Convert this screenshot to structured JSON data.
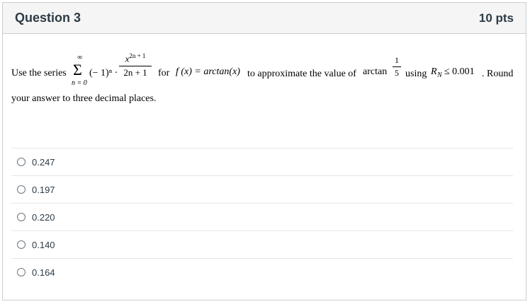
{
  "question": {
    "title": "Question 3",
    "points": "10 pts",
    "text_use_the_series": "Use the series",
    "sum_upper": "∞",
    "sum_symbol": "Σ",
    "sum_lower": "n = 0",
    "term_sign": "(− 1)ⁿ ·",
    "frac_num_base": "x",
    "frac_num_exp": "2n + 1",
    "frac_den": "2n + 1",
    "text_for": "for",
    "function": "f (x) = arctan(x)",
    "text_to_approx": "to approximate the value of",
    "arctan": "arctan",
    "arg_num": "1",
    "arg_den": "5",
    "text_using": "using",
    "condition": "R",
    "condition_sub": "N",
    "condition_rest": "≤ 0.001",
    "text_round": ". Round",
    "line2": "your answer to three decimal places."
  },
  "answers": [
    {
      "label": "0.247"
    },
    {
      "label": "0.197"
    },
    {
      "label": "0.220"
    },
    {
      "label": "0.140"
    },
    {
      "label": "0.164"
    }
  ]
}
